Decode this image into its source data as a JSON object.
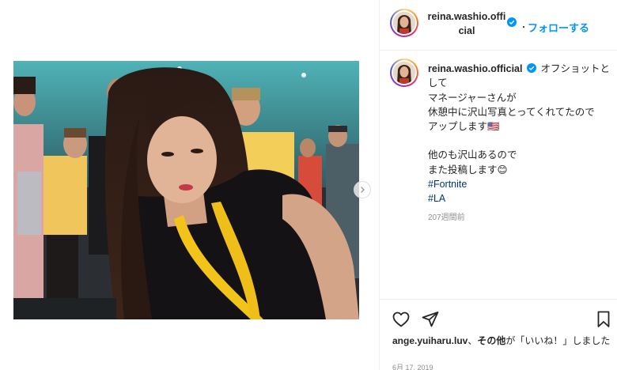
{
  "post": {
    "username": "reina.washio.official",
    "follow_label": "フォローする",
    "separator": "・"
  },
  "caption": {
    "username": "reina.washio.official",
    "lines": [
      "オフショットとして",
      "マネージャーさんが",
      "休憩中に沢山写真とってくれてたので",
      "アップします🇺🇸"
    ],
    "lines2": [
      "他のも沢山あるので",
      "また投稿します😊"
    ],
    "hashtags": [
      "#Fortnite",
      "#LA"
    ],
    "time_ago": "207週間前"
  },
  "likes": {
    "user": "ange.yuiharu.luv",
    "sep": "、",
    "others": "その他",
    "text": "が「いいね！」しました"
  },
  "date": "6月 17, 2019",
  "icons": {
    "verified": "verified-badge-icon",
    "like": "heart-icon",
    "share": "paper-plane-icon",
    "save": "bookmark-icon",
    "next": "chevron-right-icon"
  },
  "colors": {
    "accent": "#0095f6",
    "hashtag": "#00376b",
    "muted": "#8e8e8e"
  }
}
